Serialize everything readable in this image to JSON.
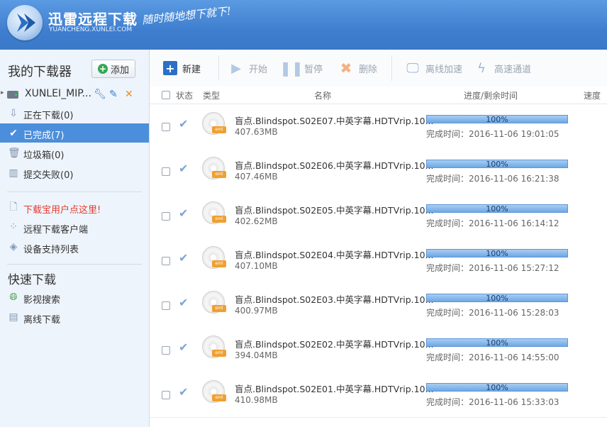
{
  "header": {
    "title": "迅雷远程下载",
    "subtitle": "YUANCHENG.XUNLEI.COM",
    "slogan": "随时随地想下就下!"
  },
  "sidebar": {
    "title": "我的下载器",
    "add_label": "添加",
    "device": {
      "name": "XUNLEI_MIP..."
    },
    "nav": [
      {
        "label": "正在下载(0)",
        "icon": "download-icon"
      },
      {
        "label": "已完成(7)",
        "icon": "check-icon"
      },
      {
        "label": "垃圾箱(0)",
        "icon": "trash-icon"
      },
      {
        "label": "提交失败(0)",
        "icon": "fail-icon"
      }
    ],
    "links": [
      {
        "label": "下载宝用户点这里!",
        "icon": "document-icon"
      },
      {
        "label": "远程下载客户端",
        "icon": "client-icon"
      },
      {
        "label": "设备支持列表",
        "icon": "layers-icon"
      }
    ],
    "quick_title": "快速下载",
    "quick": [
      {
        "label": "影视搜索",
        "icon": "globe-icon"
      },
      {
        "label": "离线下载",
        "icon": "offline-icon"
      }
    ]
  },
  "toolbar": {
    "new": "新建",
    "start": "开始",
    "pause": "暂停",
    "delete": "删除",
    "offline_accel": "离线加速",
    "high_speed": "高速通道"
  },
  "table": {
    "headers": {
      "status": "状态",
      "type": "类型",
      "name": "名称",
      "progress": "进度/剩余时间",
      "speed": "速度"
    },
    "time_label": "完成时间：",
    "rows": [
      {
        "name": "盲点.Blindspot.S02E07.中英字幕.HDTVrip.10...",
        "size": "407.63MB",
        "progress": "100%",
        "progress_value": 100,
        "time": "2016-11-06 19:01:05"
      },
      {
        "name": "盲点.Blindspot.S02E06.中英字幕.HDTVrip.10...",
        "size": "407.46MB",
        "progress": "100%",
        "progress_value": 100,
        "time": "2016-11-06 16:21:38"
      },
      {
        "name": "盲点.Blindspot.S02E05.中英字幕.HDTVrip.10...",
        "size": "402.62MB",
        "progress": "100%",
        "progress_value": 100,
        "time": "2016-11-06 16:14:12"
      },
      {
        "name": "盲点.Blindspot.S02E04.中英字幕.HDTVrip.10...",
        "size": "407.10MB",
        "progress": "100%",
        "progress_value": 100,
        "time": "2016-11-06 15:27:12"
      },
      {
        "name": "盲点.Blindspot.S02E03.中英字幕.HDTVrip.10...",
        "size": "400.97MB",
        "progress": "100%",
        "progress_value": 100,
        "time": "2016-11-06 15:28:03"
      },
      {
        "name": "盲点.Blindspot.S02E02.中英字幕.HDTVrip.10...",
        "size": "394.04MB",
        "progress": "100%",
        "progress_value": 100,
        "time": "2016-11-06 14:55:00"
      },
      {
        "name": "盲点.Blindspot.S02E01.中英字幕.HDTVrip.10...",
        "size": "410.98MB",
        "progress": "100%",
        "progress_value": 100,
        "time": "2016-11-06 15:33:03"
      }
    ],
    "file_type_tag": "eml"
  },
  "colors": {
    "accent": "#4b8fdc",
    "header": "#4a89d6",
    "progress": "#6fa9e6",
    "link_red": "#e23c30"
  }
}
